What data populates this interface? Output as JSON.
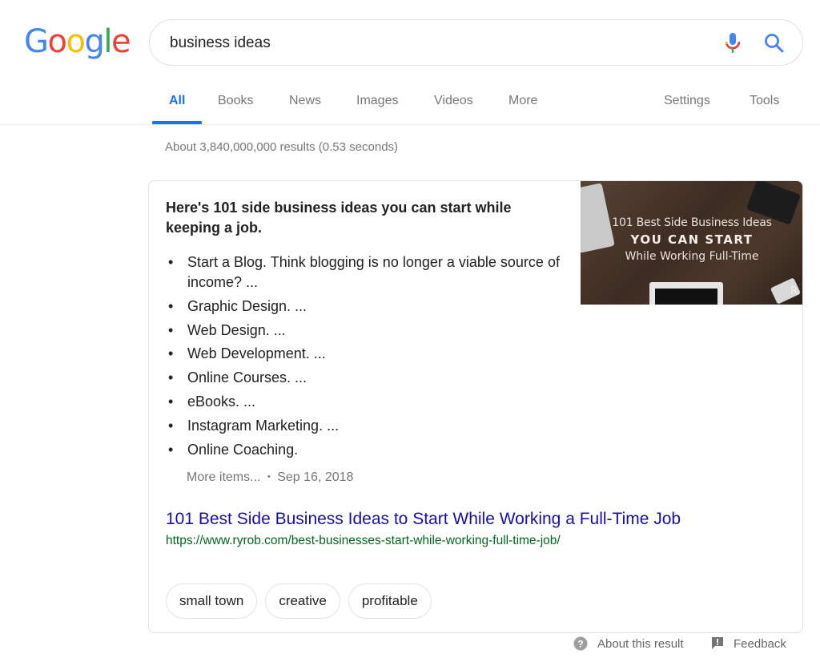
{
  "logo": {
    "letters": [
      {
        "char": "G",
        "color": "#4285f4"
      },
      {
        "char": "o",
        "color": "#ea4335"
      },
      {
        "char": "o",
        "color": "#fbbc05"
      },
      {
        "char": "g",
        "color": "#4285f4"
      },
      {
        "char": "l",
        "color": "#34a853"
      },
      {
        "char": "e",
        "color": "#ea4335"
      }
    ]
  },
  "search": {
    "query": "business ideas",
    "mic_icon": "microphone-icon",
    "search_icon": "magnifier-icon"
  },
  "tabs": {
    "items": [
      {
        "label": "All",
        "active": true
      },
      {
        "label": "Books"
      },
      {
        "label": "News"
      },
      {
        "label": "Images"
      },
      {
        "label": "Videos"
      },
      {
        "label": "More"
      }
    ],
    "settings": "Settings",
    "tools": "Tools",
    "accent_color": "#1a73e8"
  },
  "stats": "About 3,840,000,000 results (0.53 seconds)",
  "snippet": {
    "heading": "Here's 101 side business ideas you can start while keeping a job.",
    "bullets": [
      "Start a Blog. Think blogging is no longer a viable source of income? ...",
      "Graphic Design. ...",
      "Web Design. ...",
      "Web Development. ...",
      "Online Courses. ...",
      "eBooks. ...",
      "Instagram Marketing. ...",
      "Online Coaching."
    ],
    "more_items": "More items...",
    "separator": "•",
    "date": "Sep 16, 2018",
    "thumbnail": {
      "line1": "101 Best Side Business Ideas",
      "line2": "YOU CAN START",
      "line3": "While Working Full-Time",
      "brand": "R"
    },
    "result_title": "101 Best Side Business Ideas to Start While Working a Full-Time Job",
    "result_url": "https://www.ryrob.com/best-businesses-start-while-working-full-time-job/",
    "chips": [
      "small town",
      "creative",
      "profitable"
    ]
  },
  "footer": {
    "about": "About this result",
    "feedback": "Feedback"
  }
}
